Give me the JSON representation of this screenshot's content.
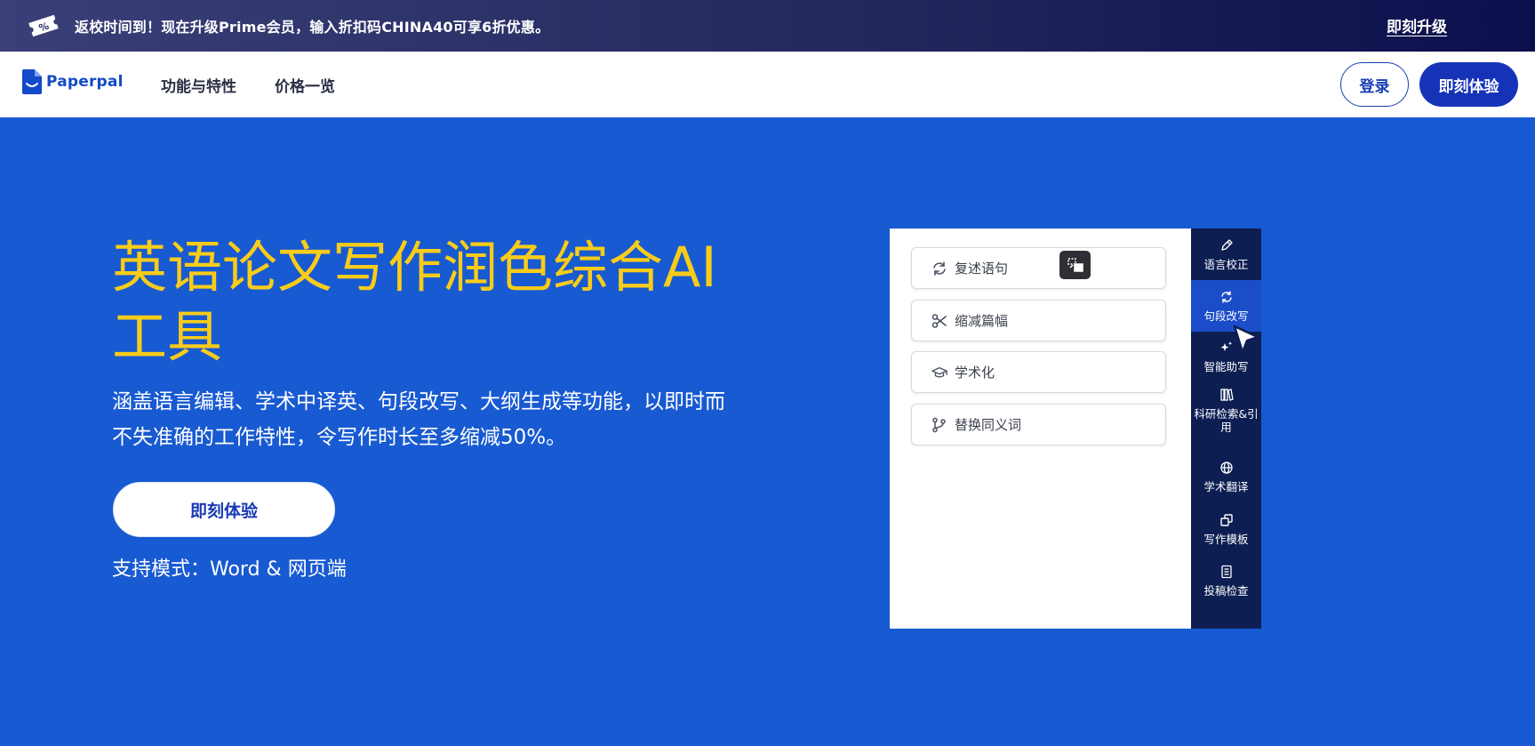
{
  "promo": {
    "text": "返校时间到！现在升级Prime会员，输入折扣码CHINA40可享6折优惠。",
    "link_label": "即刻升级"
  },
  "nav": {
    "logo_text": "Paperpal",
    "links": [
      "功能与特性",
      "价格一览"
    ],
    "login_label": "登录",
    "try_label": "即刻体验"
  },
  "hero": {
    "title": "英语论文写作润色综合AI工具",
    "subtitle": "涵盖语言编辑、学术中译英、句段改写、大纲生成等功能，以即时而不失准确的工作特性，令写作时长至多缩减50%。",
    "cta_label": "即刻体验",
    "mode_text": "支持模式：Word & 网页端"
  },
  "demo": {
    "options": [
      {
        "label": "复述语句",
        "icon": "refresh-icon"
      },
      {
        "label": "缩减篇幅",
        "icon": "scissors-icon"
      },
      {
        "label": "学术化",
        "icon": "graduation-cap-icon"
      },
      {
        "label": "替换同义词",
        "icon": "branch-icon"
      }
    ],
    "sidebar": [
      {
        "label": "语言校正",
        "icon": "pen-icon",
        "active": false
      },
      {
        "label": "句段改写",
        "icon": "rewrite-icon",
        "active": true
      },
      {
        "label": "智能助写",
        "icon": "sparkle-icon",
        "active": false
      },
      {
        "label": "科研检索&引用",
        "icon": "books-icon",
        "active": false
      },
      {
        "label": "学术翻译",
        "icon": "globe-icon",
        "active": false
      },
      {
        "label": "写作模板",
        "icon": "template-icon",
        "active": false
      },
      {
        "label": "投稿检查",
        "icon": "checklist-icon",
        "active": false
      }
    ]
  },
  "colors": {
    "hero_bg": "#185ad1",
    "title": "#f9cc19",
    "sidebar_bg": "#0d1e52",
    "sidebar_active": "#1b4dc9",
    "primary_button": "#1633b8"
  }
}
